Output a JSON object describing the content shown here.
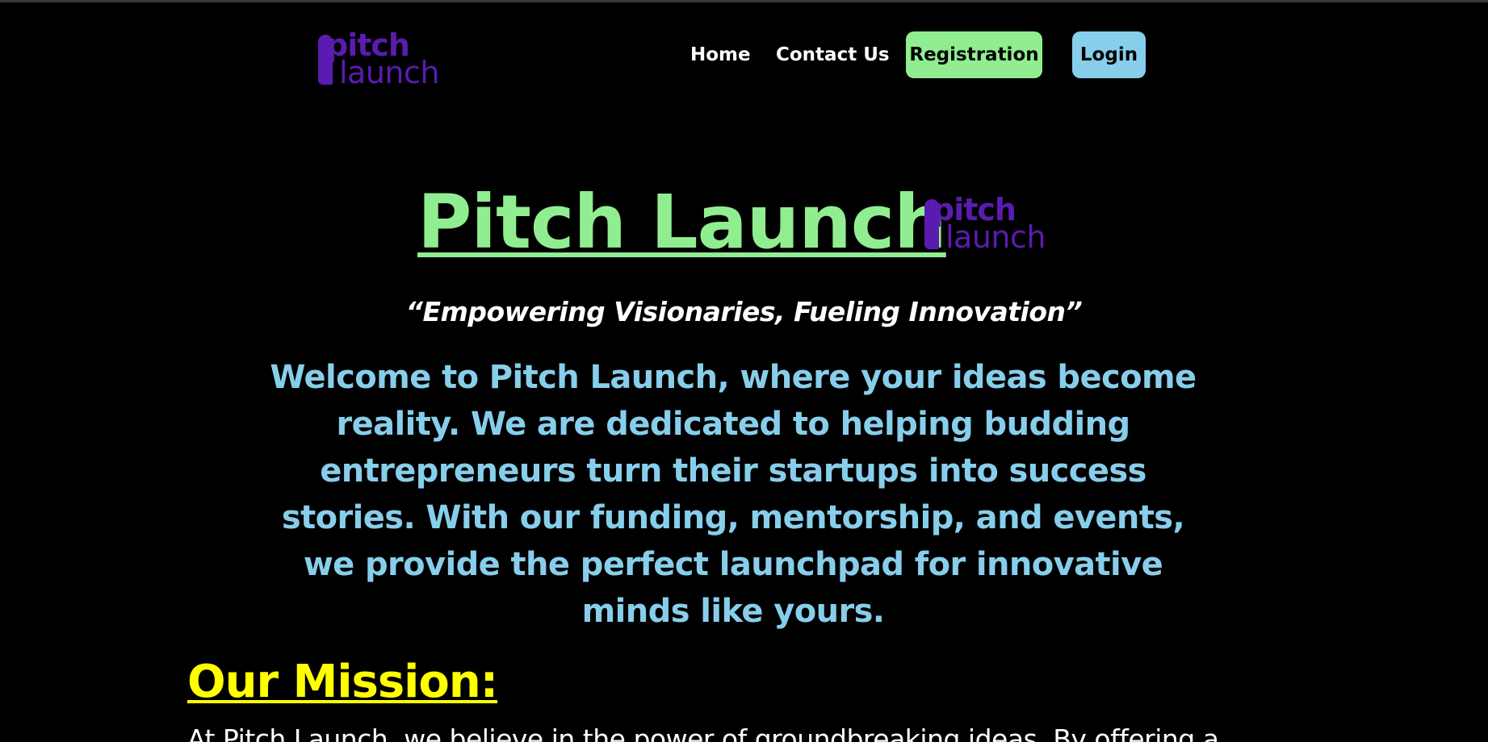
{
  "brand": {
    "logo_top": "pitch",
    "logo_bottom": "launch",
    "logo_color": "#5b1bb0"
  },
  "nav": {
    "links": [
      {
        "label": "Home"
      },
      {
        "label": "Contact Us"
      }
    ],
    "registration_label": "Registration",
    "login_label": "Login",
    "registration_color": "#90ee90",
    "login_color": "#87ceeb"
  },
  "hero": {
    "title": "Pitch Launch",
    "title_color": "#90ee90",
    "tagline": "“Empowering Visionaries, Fueling Innovation”",
    "intro": "Welcome to Pitch Launch, where your ideas become reality. We are dedicated to helping budding entrepreneurs turn their startups into success stories. With our funding, mentorship, and events, we provide the perfect launchpad for innovative minds like yours.",
    "intro_color": "#87ceeb"
  },
  "mission": {
    "heading": "Our Mission:",
    "heading_color": "#ffff00",
    "text": "At Pitch Launch, we believe in the power of groundbreaking ideas. By offering a"
  }
}
